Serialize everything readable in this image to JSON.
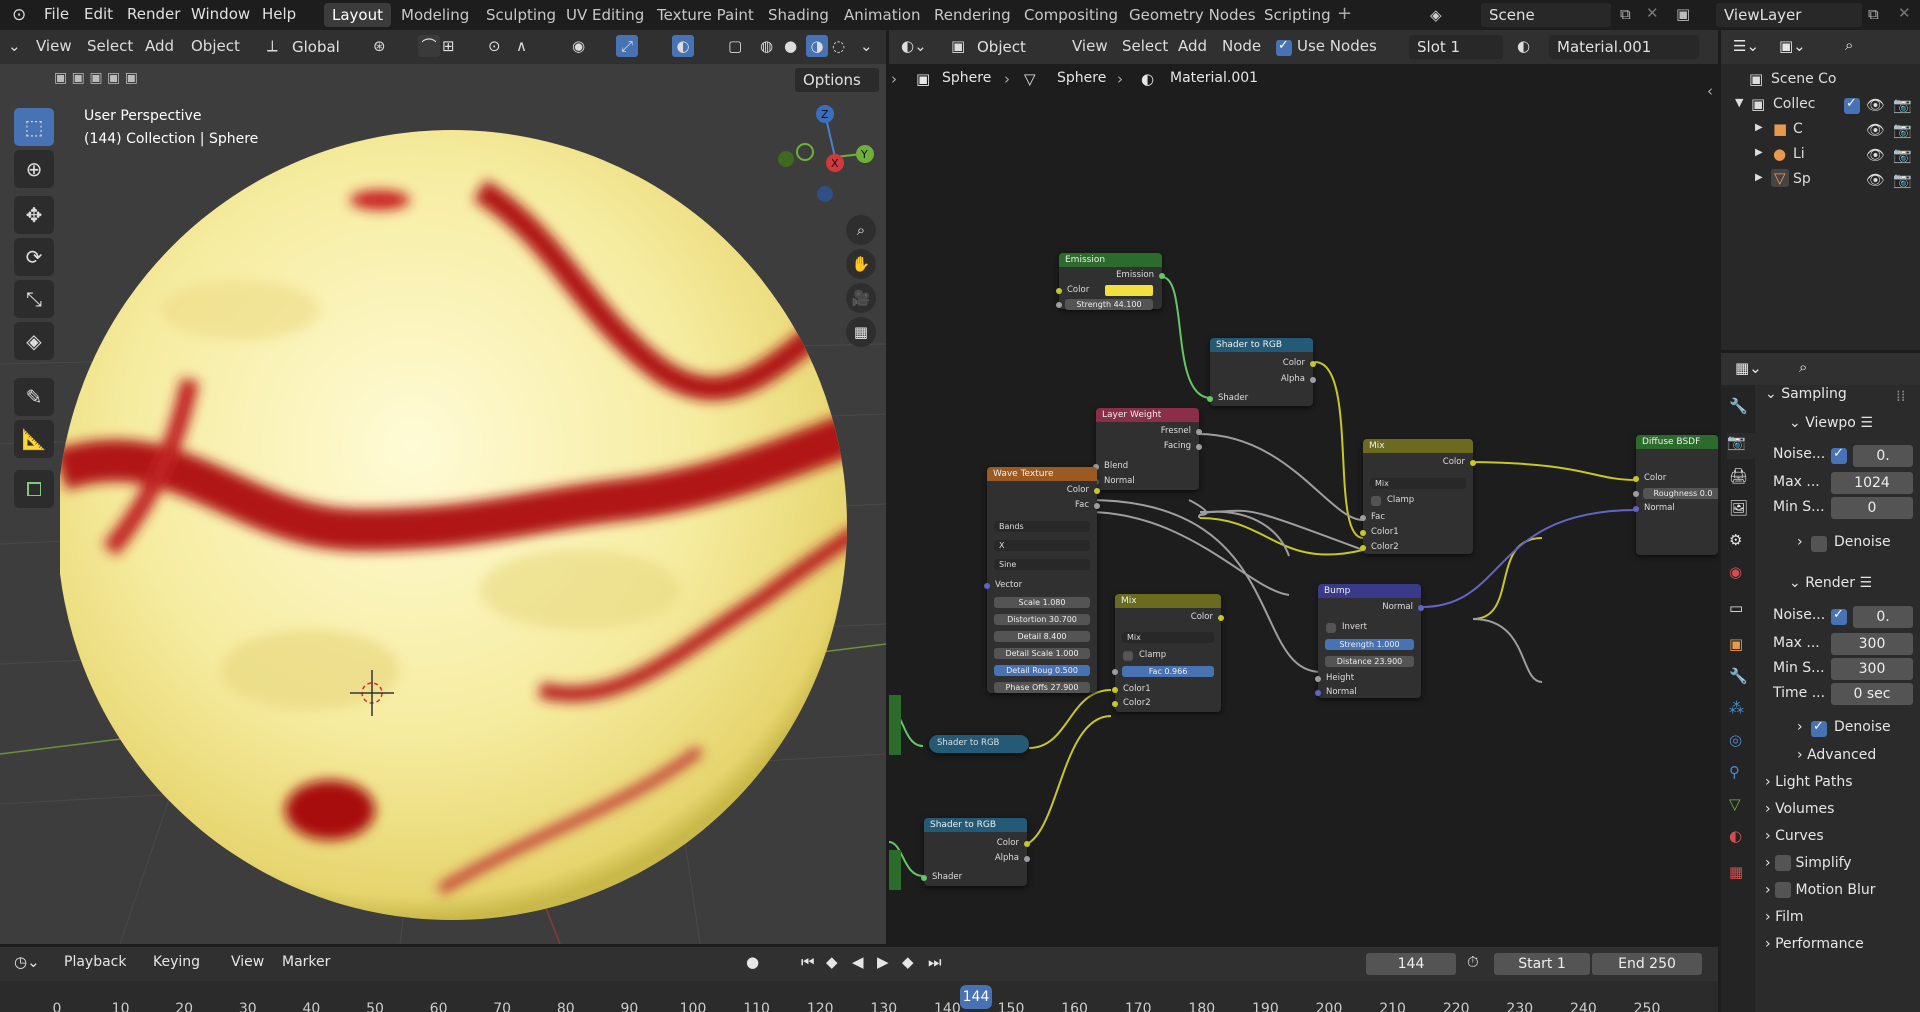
{
  "menu": {
    "file": "File",
    "edit": "Edit",
    "render": "Render",
    "window": "Window",
    "help": "Help"
  },
  "workspaces": [
    {
      "label": "Layout",
      "active": true
    },
    {
      "label": "Modeling"
    },
    {
      "label": "Sculpting"
    },
    {
      "label": "UV Editing"
    },
    {
      "label": "Texture Paint"
    },
    {
      "label": "Shading"
    },
    {
      "label": "Animation"
    },
    {
      "label": "Rendering"
    },
    {
      "label": "Compositing"
    },
    {
      "label": "Geometry Nodes"
    },
    {
      "label": "Scripting"
    }
  ],
  "scene": "Scene",
  "view_layer": "ViewLayer",
  "viewport": {
    "menus": {
      "view": "View",
      "select": "Select",
      "add": "Add",
      "object": "Object"
    },
    "orientation": "Global",
    "options": "Options",
    "info_line1": "User Perspective",
    "info_line2": "(144) Collection | Sphere"
  },
  "node_editor": {
    "mode": "Object",
    "menus": {
      "view": "View",
      "select": "Select",
      "add": "Add",
      "node": "Node"
    },
    "use_nodes": "Use Nodes",
    "slot": "Slot 1",
    "material": "Material.001",
    "breadcrumb": [
      "Sphere",
      "Sphere",
      "Material.001"
    ],
    "nodes": {
      "emission": {
        "title": "Emission",
        "out": "Emission",
        "color": "Color",
        "strength": "Strength",
        "strength_val": "44.100"
      },
      "s2r1": {
        "title": "Shader to RGB",
        "color": "Color",
        "alpha": "Alpha",
        "shader": "Shader"
      },
      "layer_weight": {
        "title": "Layer Weight",
        "fresnel": "Fresnel",
        "facing": "Facing",
        "blend": "Blend",
        "normal": "Normal"
      },
      "wave": {
        "title": "Wave Texture",
        "color": "Color",
        "fac": "Fac",
        "type": "Bands",
        "dir": "X",
        "profile": "Sine",
        "vector": "Vector",
        "fields": [
          [
            "Scale",
            "1.080"
          ],
          [
            "Distortion",
            "30.700"
          ],
          [
            "Detail",
            "8.400"
          ],
          [
            "Detail Scale",
            "1.000"
          ],
          [
            "Detail Roug",
            "0.500"
          ],
          [
            "Phase Offs",
            "27.900"
          ]
        ]
      },
      "mix1": {
        "title": "Mix",
        "color": "Color",
        "blend": "Mix",
        "clamp": "Clamp",
        "fac": "Fac",
        "color1": "Color1",
        "color2": "Color2"
      },
      "mix2": {
        "title": "Mix",
        "color": "Color",
        "blend": "Mix",
        "clamp": "Clamp",
        "fac": "Fac",
        "fac_val": "0.966",
        "color1": "Color1",
        "color2": "Color2"
      },
      "bump": {
        "title": "Bump",
        "normal_out": "Normal",
        "invert": "Invert",
        "strength": "Strength",
        "strength_val": "1.000",
        "distance": "Distance",
        "distance_val": "23.900",
        "height": "Height",
        "normal": "Normal"
      },
      "diffuse": {
        "title": "Diffuse BSDF",
        "color": "Color",
        "roughness": "Roughness",
        "rough_val": "0.0",
        "normal": "Normal"
      },
      "s2r2": {
        "title": "Shader to RGB"
      },
      "s2r3": {
        "title": "Shader to RGB",
        "color": "Color",
        "alpha": "Alpha",
        "shader": "Shader"
      }
    }
  },
  "outliner": {
    "root": "Scene Co",
    "items": [
      {
        "label": "Collec"
      },
      {
        "label": "C"
      },
      {
        "label": "Li"
      },
      {
        "label": "Sp"
      }
    ]
  },
  "properties": {
    "sampling": "Sampling",
    "viewport": "Viewpo",
    "v_noise": "Noise...",
    "v_noise_val": "0.",
    "v_max": "Max ...",
    "v_max_val": "1024",
    "v_min": "Min S...",
    "v_min_val": "0",
    "denoise": "Denoise",
    "render": "Render",
    "r_noise": "Noise...",
    "r_noise_val": "0.",
    "r_max": "Max ...",
    "r_max_val": "300",
    "r_min": "Min S...",
    "r_min_val": "300",
    "r_time": "Time ...",
    "r_time_val": "0 sec",
    "r_denoise": "Denoise",
    "advanced": "Advanced",
    "sections": [
      "Light Paths",
      "Volumes",
      "Curves",
      "Simplify",
      "Motion Blur",
      "Film",
      "Performance"
    ]
  },
  "timeline": {
    "menus": {
      "playback": "Playback",
      "keying": "Keying",
      "view": "View",
      "marker": "Marker"
    },
    "current_frame": "144",
    "start_label": "Start",
    "start": "1",
    "end_label": "End",
    "end": "250",
    "ticks": [
      "0",
      "10",
      "20",
      "30",
      "40",
      "50",
      "60",
      "70",
      "80",
      "90",
      "100",
      "110",
      "120",
      "130",
      "140",
      "150",
      "160",
      "170",
      "180",
      "190",
      "200",
      "210",
      "220",
      "230",
      "240",
      "250"
    ]
  },
  "colors": {
    "accent": "#4772b3",
    "emission_color": "#f0e040"
  }
}
